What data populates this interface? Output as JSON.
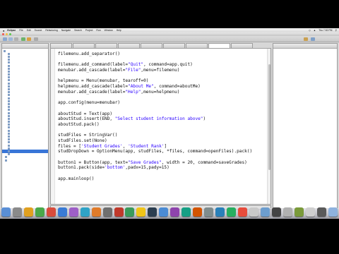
{
  "macos_menubar": {
    "app_name": "Eclipse",
    "items": [
      "File",
      "Edit",
      "Source",
      "Refactoring",
      "Navigate",
      "Search",
      "Project",
      "Run",
      "Window",
      "Help"
    ],
    "clock": "Thu 7:52 PM"
  },
  "editor": {
    "lines": [
      {
        "parts": [
          {
            "t": "filemenu.add_separator()"
          }
        ]
      },
      {
        "parts": [
          {
            "t": ""
          }
        ]
      },
      {
        "parts": [
          {
            "t": "filemenu.add_command(label="
          },
          {
            "t": "\"Quit\"",
            "s": true
          },
          {
            "t": ", command=app.quit)"
          }
        ]
      },
      {
        "parts": [
          {
            "t": "menubar.add_cascade(label="
          },
          {
            "t": "\"File\"",
            "s": true
          },
          {
            "t": ",menu=filemenu)"
          }
        ]
      },
      {
        "parts": [
          {
            "t": ""
          }
        ]
      },
      {
        "parts": [
          {
            "t": "helpmenu = Menu(menubar, tearoff=0)"
          }
        ]
      },
      {
        "parts": [
          {
            "t": "helpmenu.add_cascade(label="
          },
          {
            "t": "\"About Me\"",
            "s": true
          },
          {
            "t": ", command=aboutMe)"
          }
        ]
      },
      {
        "parts": [
          {
            "t": "menubar.add_cascade(label="
          },
          {
            "t": "\"Help\"",
            "s": true
          },
          {
            "t": ",menu=helpmenu)"
          }
        ]
      },
      {
        "parts": [
          {
            "t": ""
          }
        ]
      },
      {
        "parts": [
          {
            "t": "app.config(menu=menubar)"
          }
        ]
      },
      {
        "parts": [
          {
            "t": ""
          }
        ]
      },
      {
        "parts": [
          {
            "t": "aboutStud = Text(app)"
          }
        ]
      },
      {
        "parts": [
          {
            "t": "aboutStud.insert(END, "
          },
          {
            "t": "\"Select student information above\"",
            "s": true
          },
          {
            "t": ")"
          }
        ]
      },
      {
        "parts": [
          {
            "t": "aboutStud.pack()"
          }
        ]
      },
      {
        "parts": [
          {
            "t": ""
          }
        ]
      },
      {
        "parts": [
          {
            "t": "studFiles = StringVar()"
          }
        ]
      },
      {
        "parts": [
          {
            "t": "studFiles.set(None)"
          }
        ]
      },
      {
        "parts": [
          {
            "t": "files = ["
          },
          {
            "t": "'Student Grades'",
            "s": true
          },
          {
            "t": ", "
          },
          {
            "t": "'Student Rank'",
            "s": true
          },
          {
            "t": "]"
          }
        ]
      },
      {
        "parts": [
          {
            "t": "studDropDown = OptionMenu(app, studFiles, *files, command=openFiles).pack()"
          }
        ]
      },
      {
        "parts": [
          {
            "t": ""
          }
        ]
      },
      {
        "parts": [
          {
            "t": "button1 = Button(app, text="
          },
          {
            "t": "\"Save Grades\"",
            "s": true
          },
          {
            "t": ", width = 20, command=saveGrades)"
          }
        ]
      },
      {
        "parts": [
          {
            "t": "button1.pack(side="
          },
          {
            "t": "'bottom'",
            "s": true
          },
          {
            "t": ",padx=15,pady=15)"
          }
        ]
      },
      {
        "parts": [
          {
            "t": ""
          }
        ]
      },
      {
        "parts": [
          {
            "t": "app.mainloop()"
          }
        ]
      }
    ]
  },
  "colors": {
    "string": "#2a00ff",
    "selection": "#3875d7",
    "traffic_close": "#f2544f",
    "traffic_min": "#f5bd3a",
    "traffic_max": "#5bc94e"
  },
  "dock_icon_colors": [
    "#5a8fd6",
    "#8a8a8a",
    "#e0a020",
    "#4aa84a",
    "#d94c3c",
    "#3a7bd5",
    "#9e5fc7",
    "#2fa3c7",
    "#e07b2a",
    "#6f6f6f",
    "#c0392b",
    "#3a9a5b",
    "#f0c419",
    "#2c3e50",
    "#4b8bd4",
    "#8e44ad",
    "#16a085",
    "#d35400",
    "#7f8c8d",
    "#2980b9",
    "#27ae60",
    "#e74c3c",
    "#c9c9c9",
    "#6d9ecf",
    "#444444",
    "#b0b0b0",
    "#7a9a3a",
    "#cfcfcf",
    "#5a5a5a",
    "#8fb3de"
  ]
}
